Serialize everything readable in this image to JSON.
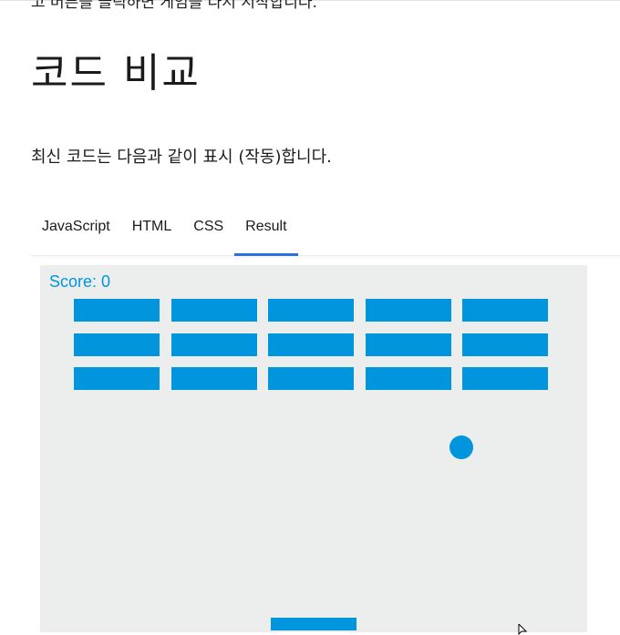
{
  "article": {
    "cut_text": "고 버튼을 클릭하면 게임을 다시 시작합니다.",
    "heading": "코드 비교",
    "intro": "최신 코드는 다음과 같이 표시 (작동)합니다."
  },
  "tabs": [
    {
      "label": "JavaScript",
      "active": false
    },
    {
      "label": "HTML",
      "active": false
    },
    {
      "label": "CSS",
      "active": false
    },
    {
      "label": "Result",
      "active": true
    }
  ],
  "game": {
    "score_text": "Score: 0",
    "brick_rows": 3,
    "brick_columns": 5,
    "colors": {
      "accent": "#0095dd",
      "background": "#eceeee",
      "tab_indicator": "#2b6fe0"
    }
  }
}
